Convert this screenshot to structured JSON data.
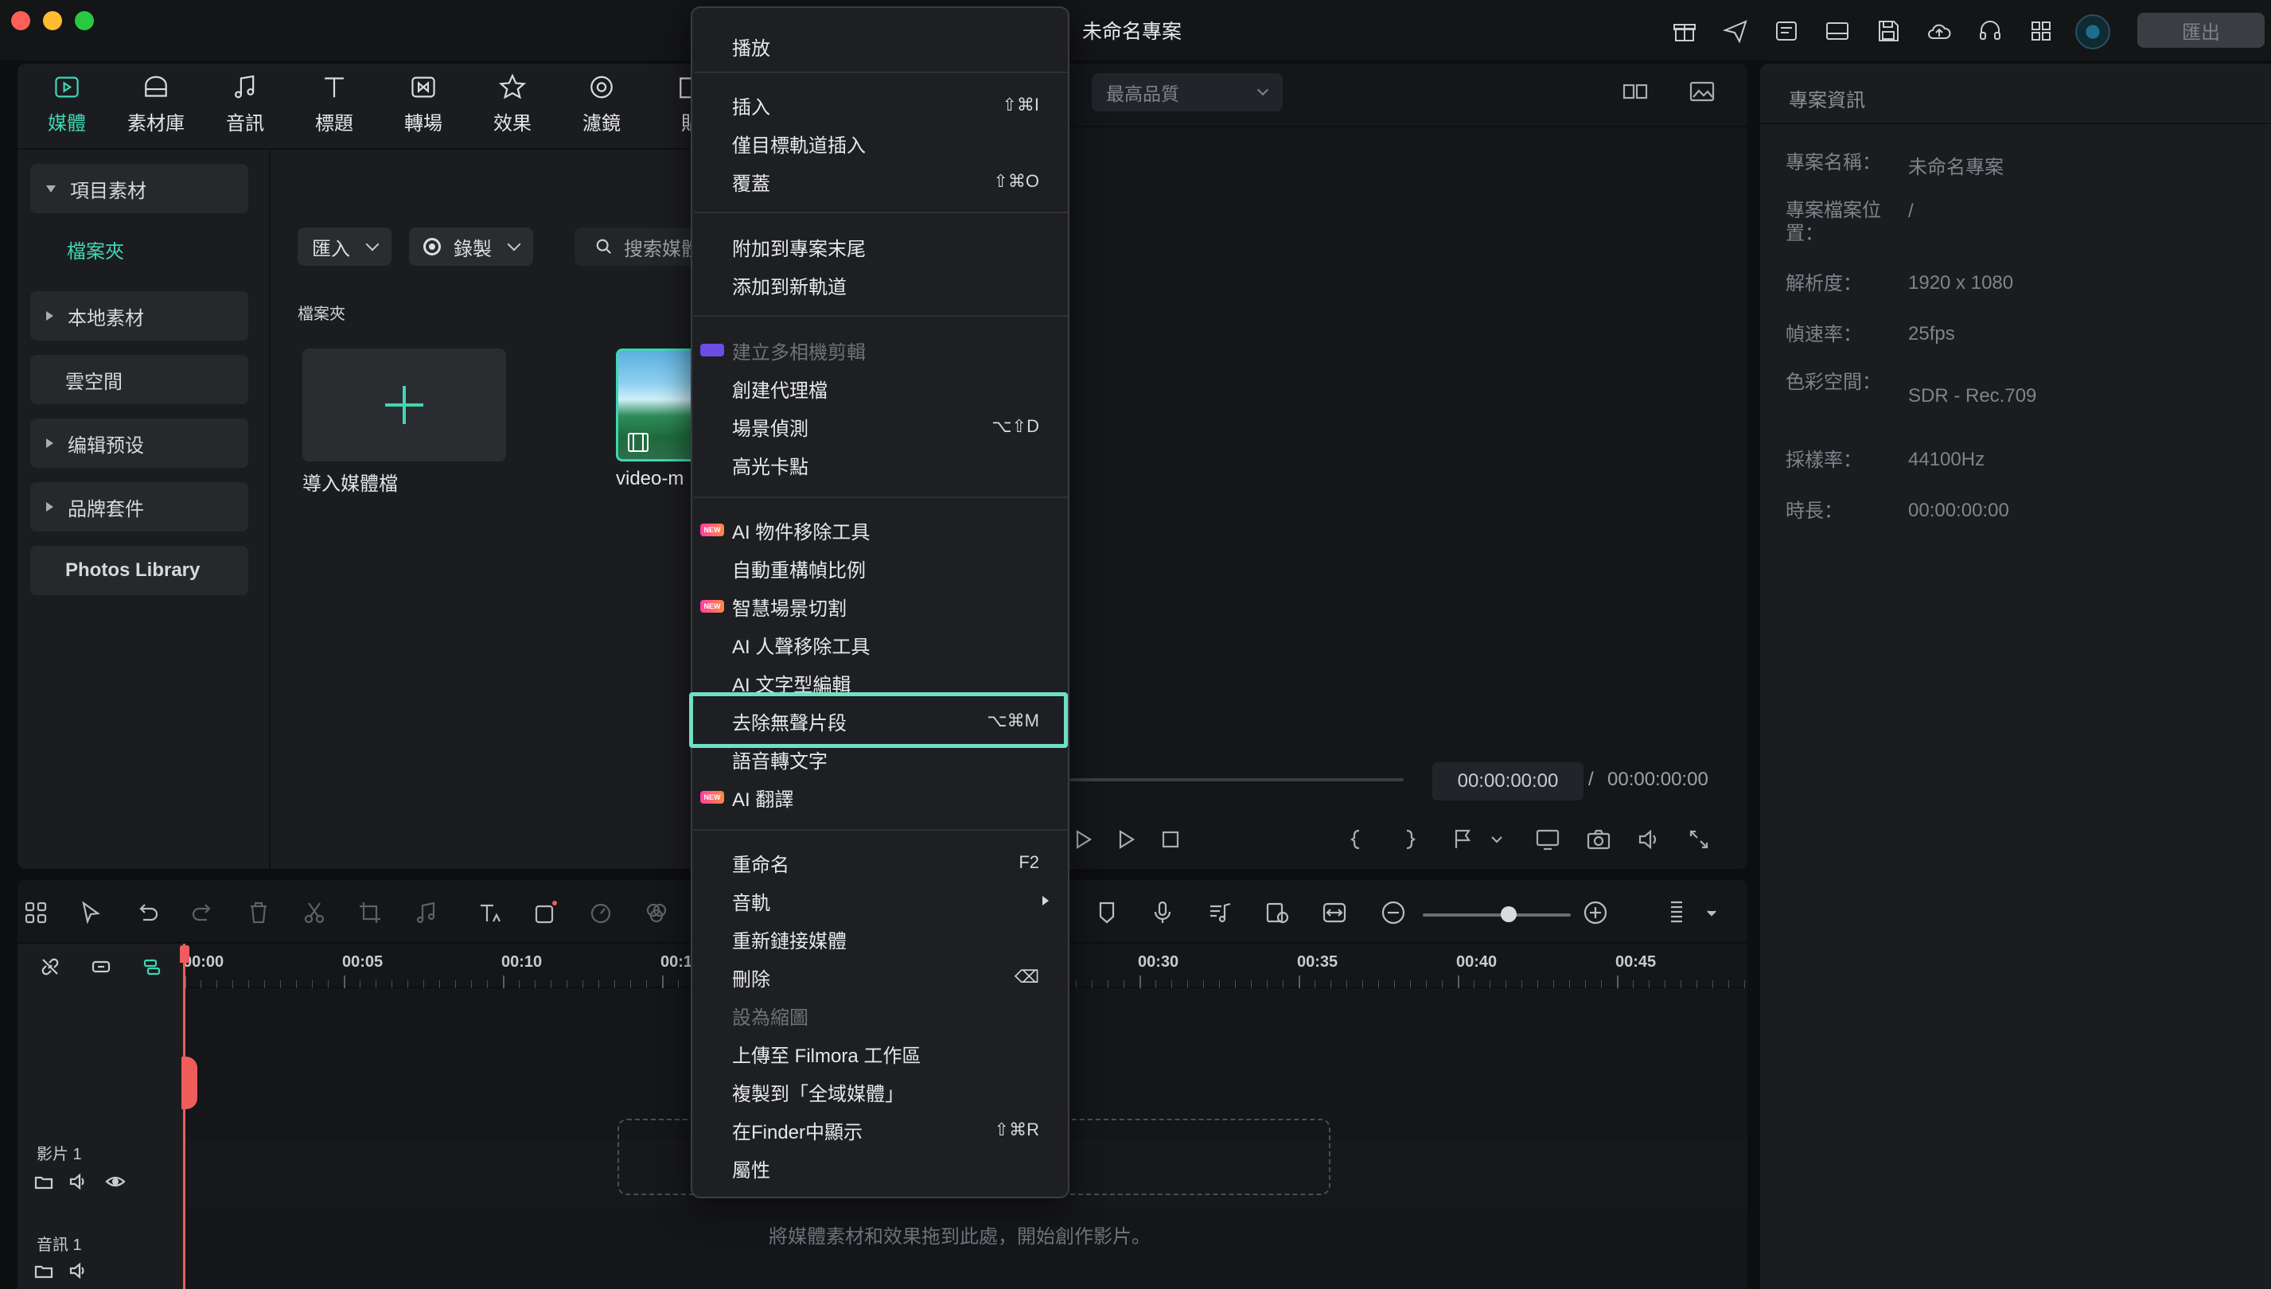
{
  "app": {
    "title": "未命名專案",
    "export_label": "匯出"
  },
  "toolbar_tabs": [
    {
      "label": "媒體",
      "icon": "media-icon",
      "active": true
    },
    {
      "label": "素材庫",
      "icon": "stock-icon",
      "active": false
    },
    {
      "label": "音訊",
      "icon": "music-note-icon",
      "active": false
    },
    {
      "label": "標題",
      "icon": "title-t-icon",
      "active": false
    },
    {
      "label": "轉場",
      "icon": "transition-icon",
      "active": false
    },
    {
      "label": "效果",
      "icon": "effects-icon",
      "active": false
    },
    {
      "label": "濾鏡",
      "icon": "filter-icon",
      "active": false
    },
    {
      "label": "貼",
      "icon": "sticker-icon",
      "active": false
    }
  ],
  "sidebar": {
    "items": [
      {
        "label": "項目素材",
        "expanded": true
      },
      {
        "label": "檔案夾",
        "active": true
      },
      {
        "label": "本地素材",
        "expanded": false
      },
      {
        "label": "雲空間"
      },
      {
        "label": "编辑预设",
        "expanded": false
      },
      {
        "label": "品牌套件",
        "expanded": false
      },
      {
        "label": "Photos Library"
      }
    ]
  },
  "media": {
    "import_label": "匯入",
    "record_label": "錄製",
    "search_placeholder": "搜索媒體",
    "folder_label": "檔案夾",
    "import_tile_label": "導入媒體檔",
    "video_label": "video-m"
  },
  "preview": {
    "quality": "最高品質",
    "current_time": "00:00:00:00",
    "slash": "/",
    "total_time": "00:00:00:00"
  },
  "info": {
    "title": "專案資訊",
    "rows": [
      {
        "key": "專案名稱：",
        "value": "未命名專案"
      },
      {
        "key": "專案檔案位置：",
        "value": "/"
      },
      {
        "key": "解析度：",
        "value": "1920 x 1080"
      },
      {
        "key": "幀速率：",
        "value": "25fps"
      },
      {
        "key": "色彩空間：",
        "value": "SDR - Rec.709"
      },
      {
        "key": "採樣率：",
        "value": "44100Hz"
      },
      {
        "key": "時長：",
        "value": "00:00:00:00"
      }
    ]
  },
  "timeline": {
    "ticks": [
      "00:00",
      "00:05",
      "00:10",
      "00:1",
      "00:30",
      "00:35",
      "00:40",
      "00:45"
    ],
    "tracks": [
      {
        "label": "影片 1"
      },
      {
        "label": "音訊 1"
      }
    ],
    "drop_hint": "將媒體素材和效果拖到此處，開始創作影片。"
  },
  "context_menu": {
    "items": [
      {
        "label": "播放",
        "shortcut": ""
      },
      {
        "label": "插入",
        "shortcut": "⇧⌘I"
      },
      {
        "label": "僅目標軌道插入",
        "shortcut": ""
      },
      {
        "label": "覆蓋",
        "shortcut": "⇧⌘O"
      },
      {
        "label": "附加到專案末尾",
        "shortcut": ""
      },
      {
        "label": "添加到新軌道",
        "shortcut": ""
      },
      {
        "label": "建立多相機剪輯",
        "shortcut": "",
        "disabled": true
      },
      {
        "label": "創建代理檔",
        "shortcut": ""
      },
      {
        "label": "場景偵測",
        "shortcut": "⌥⇧D"
      },
      {
        "label": "高光卡點",
        "shortcut": ""
      },
      {
        "label": "AI 物件移除工具",
        "shortcut": "",
        "badge": "NEW"
      },
      {
        "label": "自動重構幀比例",
        "shortcut": ""
      },
      {
        "label": "智慧場景切割",
        "shortcut": "",
        "badge": "NEW"
      },
      {
        "label": "AI 人聲移除工具",
        "shortcut": ""
      },
      {
        "label": "AI 文字型編輯",
        "shortcut": ""
      },
      {
        "label": "去除無聲片段",
        "shortcut": "⌥⌘M",
        "highlighted": true
      },
      {
        "label": "語音轉文字",
        "shortcut": ""
      },
      {
        "label": "AI 翻譯",
        "shortcut": "",
        "badge": "NEW"
      },
      {
        "label": "重命名",
        "shortcut": "F2"
      },
      {
        "label": "音軌",
        "shortcut": ""
      },
      {
        "label": "重新鏈接媒體",
        "shortcut": ""
      },
      {
        "label": "刪除",
        "shortcut": "⌫"
      },
      {
        "label": "設為縮圖",
        "shortcut": "",
        "disabled": true
      },
      {
        "label": "上傳至 Filmora 工作區",
        "shortcut": ""
      },
      {
        "label": "複製到「全域媒體」",
        "shortcut": ""
      },
      {
        "label": "在Finder中顯示",
        "shortcut": "⇧⌘R"
      },
      {
        "label": "屬性",
        "shortcut": ""
      }
    ],
    "badge_text": "NEW"
  },
  "colors": {
    "accent": "#3fd6b5",
    "highlight_border": "#6fe0c4",
    "playhead": "#ee5c5c"
  }
}
